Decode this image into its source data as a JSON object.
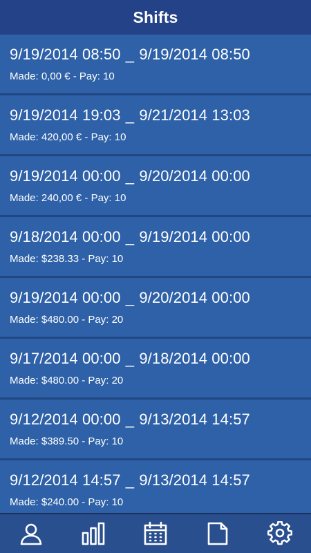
{
  "header": {
    "title": "Shifts"
  },
  "shifts": [
    {
      "start": "9/19/2014 08:50",
      "end": "9/19/2014 08:50",
      "made": "Made: 0,00 € - Pay: 10"
    },
    {
      "start": "9/19/2014 19:03",
      "end": "9/21/2014 13:03",
      "made": "Made: 420,00 € - Pay: 10"
    },
    {
      "start": "9/19/2014 00:00",
      "end": "9/20/2014 00:00",
      "made": "Made: 240,00 € - Pay: 10"
    },
    {
      "start": "9/18/2014 00:00",
      "end": "9/19/2014 00:00",
      "made": "Made: $238.33 - Pay: 10"
    },
    {
      "start": "9/19/2014 00:00",
      "end": "9/20/2014 00:00",
      "made": "Made: $480.00 - Pay: 20"
    },
    {
      "start": "9/17/2014 00:00",
      "end": "9/18/2014 00:00",
      "made": "Made: $480.00 - Pay: 20"
    },
    {
      "start": "9/12/2014 00:00",
      "end": "9/13/2014 14:57",
      "made": "Made: $389.50 - Pay: 10"
    },
    {
      "start": "9/12/2014 14:57",
      "end": "9/13/2014 14:57",
      "made": "Made: $240.00 - Pay: 10"
    }
  ],
  "separator": "_",
  "tabbar": {
    "items": [
      {
        "icon": "person-icon"
      },
      {
        "icon": "bar-chart-icon"
      },
      {
        "icon": "calendar-icon"
      },
      {
        "icon": "document-icon"
      },
      {
        "icon": "gear-icon"
      }
    ]
  }
}
